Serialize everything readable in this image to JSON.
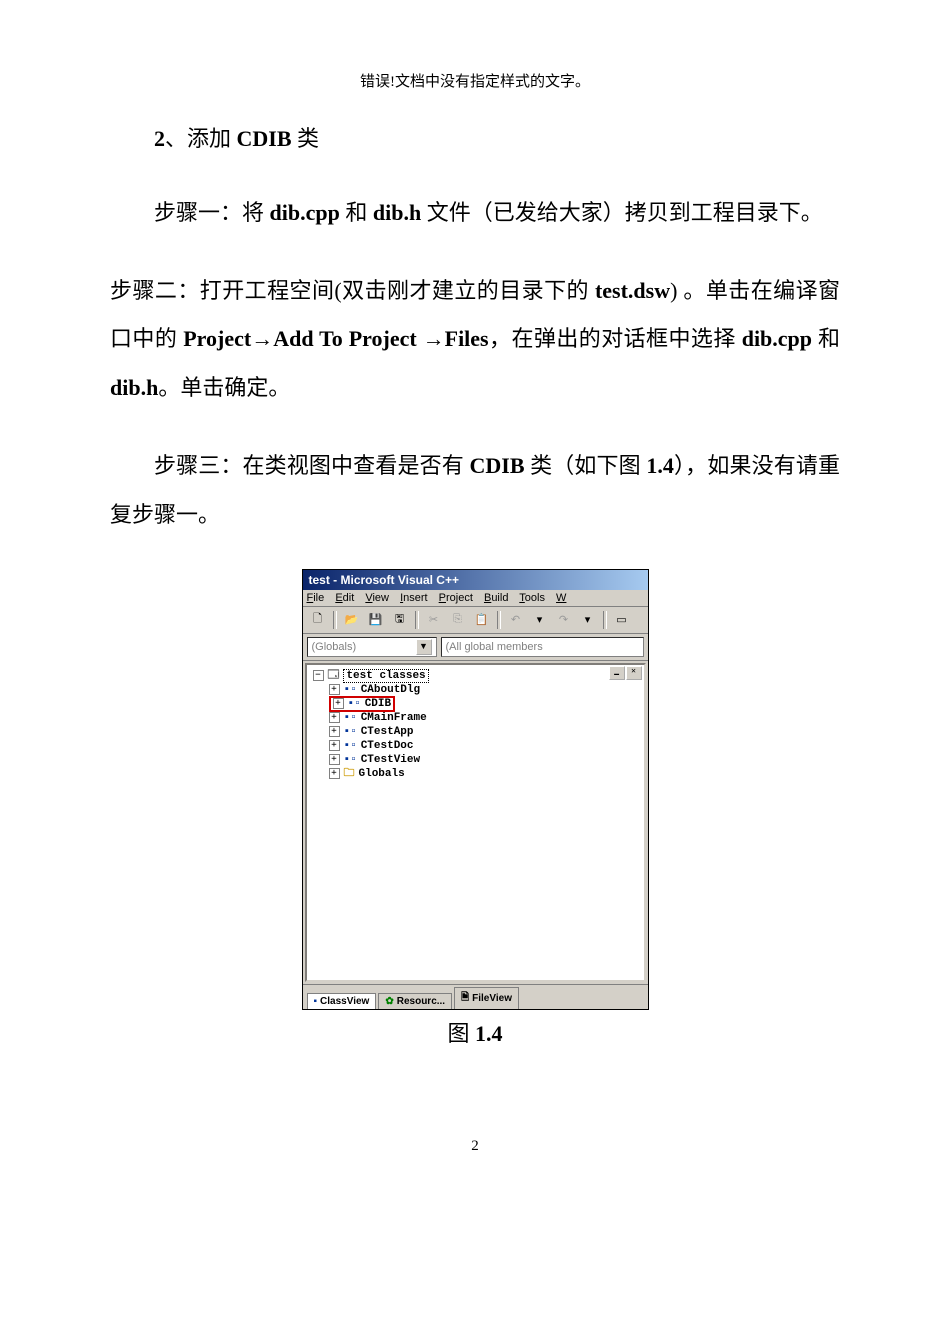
{
  "header": {
    "error_text": "错误!文档中没有指定样式的文字。"
  },
  "section": {
    "num": "2",
    "sep": "、",
    "action": "添加 ",
    "classname": "CDIB",
    "suffix": " 类"
  },
  "step1": {
    "prefix": "步骤一：将 ",
    "f1": "dib.cpp",
    "mid": " 和 ",
    "f2": "dib.h",
    "tail": " 文件（已发给大家）拷贝到工程目录下。"
  },
  "step2": {
    "line1_prefix": "步骤二：打开工程空间(双击刚才建立的目录下的",
    "file": "test.dsw",
    "after_file": ") 。单击在编译窗口中的 ",
    "proj": "Project",
    "arrow1": "→",
    "addto": "Add To Project",
    "arrow2": "→",
    "files": "Files",
    "comma": "，",
    "mid": "在弹出的对话框中选择 ",
    "f1": "dib.cpp",
    "and": " 和 ",
    "f2": "dib.h",
    "end": "。单击确定。"
  },
  "step3": {
    "prefix": "步骤三：在类视图中查看是否有 ",
    "cls": "CDIB",
    "mid": " 类（如下图 ",
    "fig": "1.4",
    "after": "），如果没有请重复步骤一。"
  },
  "vc": {
    "title": "test - Microsoft Visual C++",
    "menu": {
      "file": "File",
      "edit": "Edit",
      "view": "View",
      "insert": "Insert",
      "project": "Project",
      "build": "Build",
      "tools": "Tools",
      "window": "W"
    },
    "toolbar": {
      "new": "🗋",
      "open": "📂",
      "save": "💾",
      "saveall": "🖫",
      "cut": "✂",
      "copy": "⎘",
      "paste": "📋",
      "undo": "↶",
      "redo": "↷",
      "stop": "▭"
    },
    "combo1": "(Globals)",
    "combo2": "(All global members",
    "tree": {
      "root": "test classes",
      "items": [
        {
          "label": "CAboutDlg",
          "icon": "cls"
        },
        {
          "label": "CDIB",
          "icon": "cls",
          "highlight": true
        },
        {
          "label": "CMainFrame",
          "icon": "cls"
        },
        {
          "label": "CTestApp",
          "icon": "cls"
        },
        {
          "label": "CTestDoc",
          "icon": "cls"
        },
        {
          "label": "CTestView",
          "icon": "cls"
        },
        {
          "label": "Globals",
          "icon": "fld"
        }
      ]
    },
    "tabs": {
      "classview": "ClassView",
      "resource": "Resourc...",
      "fileview": "FileView"
    }
  },
  "caption": {
    "pre": "图 ",
    "num": "1.4"
  },
  "page_number": "2"
}
